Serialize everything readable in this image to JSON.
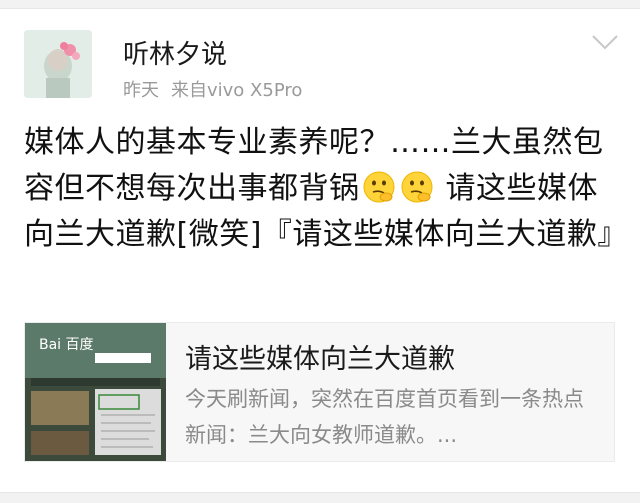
{
  "post": {
    "author": "听林夕说",
    "time": "昨天",
    "source": "来自vivo X5Pro",
    "text_part1": "媒体人的基本专业素养呢？……兰大虽然包容但不想每次出事都背锅",
    "text_part2": " 请这些媒体向兰大道歉[微笑]『请这些媒体向兰大道歉』",
    "emoji_icons": [
      "thinking-emoji-icon",
      "thinking-emoji-icon"
    ]
  },
  "card": {
    "title": "请这些媒体向兰大道歉",
    "description": "今天刷新闻，突然在百度首页看到一条热点新闻：兰大向女教师道歉。...",
    "thumbnail_brand": "Bai 百度"
  },
  "colors": {
    "text": "#111111",
    "meta": "#9a9a9a",
    "card_bg": "#f7f7f7",
    "card_desc": "#8a8a8a"
  }
}
